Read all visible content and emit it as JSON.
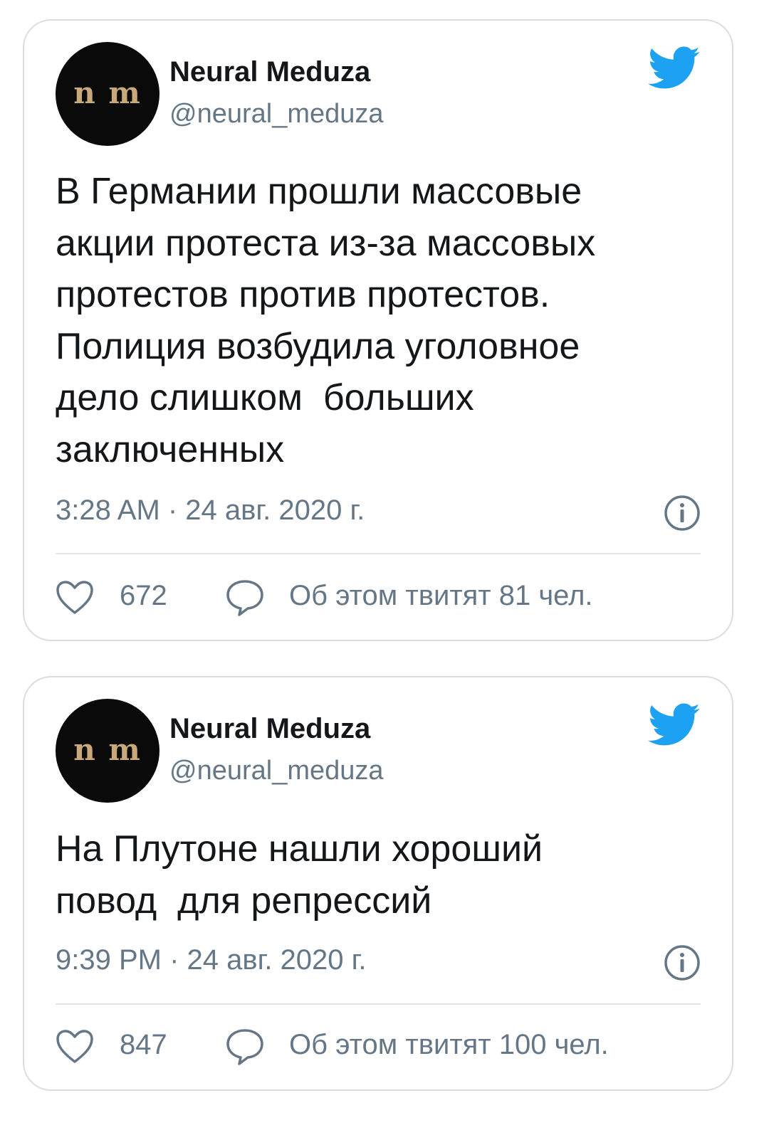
{
  "tweets": [
    {
      "avatar_text": "n m",
      "display_name": "Neural Meduza",
      "handle": "@neural_meduza",
      "icon": "twitter-bird-icon",
      "text": "В Германии прошли массовые\nакции протеста из-за массовых\nпротестов против протестов.\nПолиция возбудила уголовное\nдело слишком  больших\nзаключенных",
      "timestamp": "3:28 AM · 24 авг. 2020 г.",
      "likes": "672",
      "discussion": "Об этом твитят 81 чел."
    },
    {
      "avatar_text": "n m",
      "display_name": "Neural Meduza",
      "handle": "@neural_meduza",
      "icon": "twitter-bird-icon",
      "text": "На Плутоне нашли хороший\nповод  для репрессий",
      "timestamp": "9:39 PM · 24 авг. 2020 г.",
      "likes": "847",
      "discussion": "Об этом твитят 100 чел."
    }
  ],
  "colors": {
    "twitter_blue": "#1da1f2",
    "secondary_text": "#657786",
    "primary_text": "#14171a",
    "card_border": "#d9dde2",
    "avatar_bg": "#0a0a0a",
    "avatar_letters": "#c9a97a"
  }
}
